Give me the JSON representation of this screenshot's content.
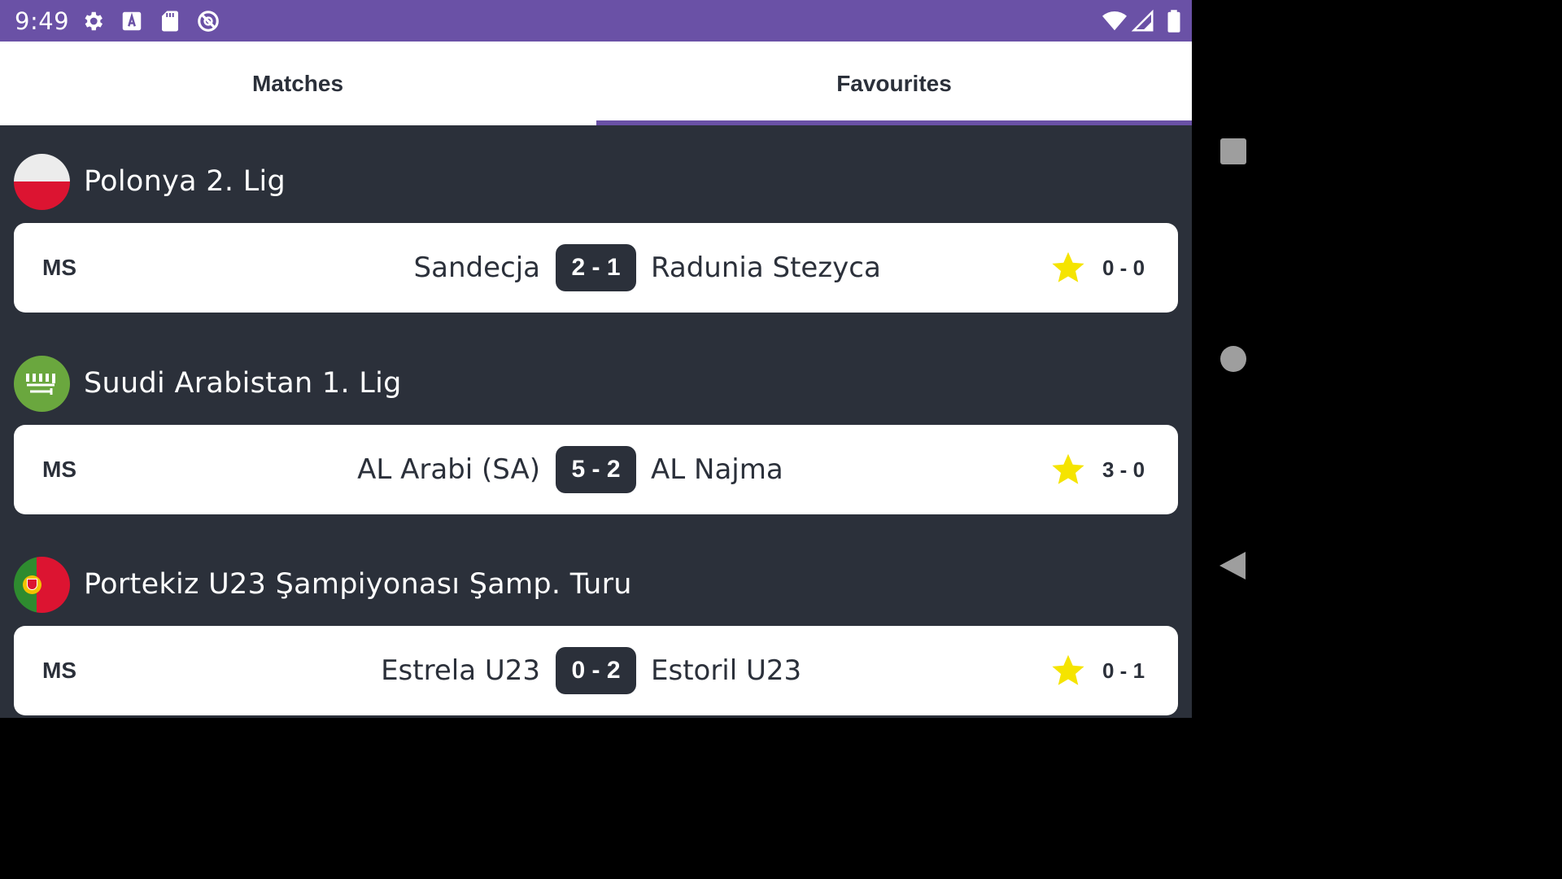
{
  "status_bar": {
    "time": "9:49",
    "icons": [
      "gear-icon",
      "a-keyboard-icon",
      "sd-card-icon",
      "no-sync-icon",
      "wifi-icon",
      "signal-icon",
      "battery-icon"
    ],
    "background": "#6a51a6"
  },
  "tabs": [
    {
      "label": "Matches",
      "selected": false
    },
    {
      "label": "Favourites",
      "selected": true
    }
  ],
  "colors": {
    "accent": "#6a51a6",
    "dark": "#2b303a",
    "star": "#f5e400"
  },
  "leagues": [
    {
      "name": "Polonya 2. Lig",
      "flag": "poland-flag-icon",
      "match": {
        "status": "MS",
        "home": "Sandecja",
        "score": "2 - 1",
        "away": "Radunia Stezyca",
        "halftime": "0 - 0",
        "favourite": true
      }
    },
    {
      "name": "Suudi Arabistan 1. Lig",
      "flag": "saudi-arabia-flag-icon",
      "match": {
        "status": "MS",
        "home": "AL Arabi (SA)",
        "score": "5 - 2",
        "away": "AL Najma",
        "halftime": "3 - 0",
        "favourite": true
      }
    },
    {
      "name": "Portekiz U23 Şampiyonası Şamp. Turu",
      "flag": "portugal-flag-icon",
      "match": {
        "status": "MS",
        "home": "Estrela U23",
        "score": "0 - 2",
        "away": "Estoril U23",
        "halftime": "0 - 1",
        "favourite": true
      }
    }
  ],
  "nav_bar": {
    "buttons": [
      "recents-icon",
      "home-icon",
      "back-icon"
    ]
  }
}
